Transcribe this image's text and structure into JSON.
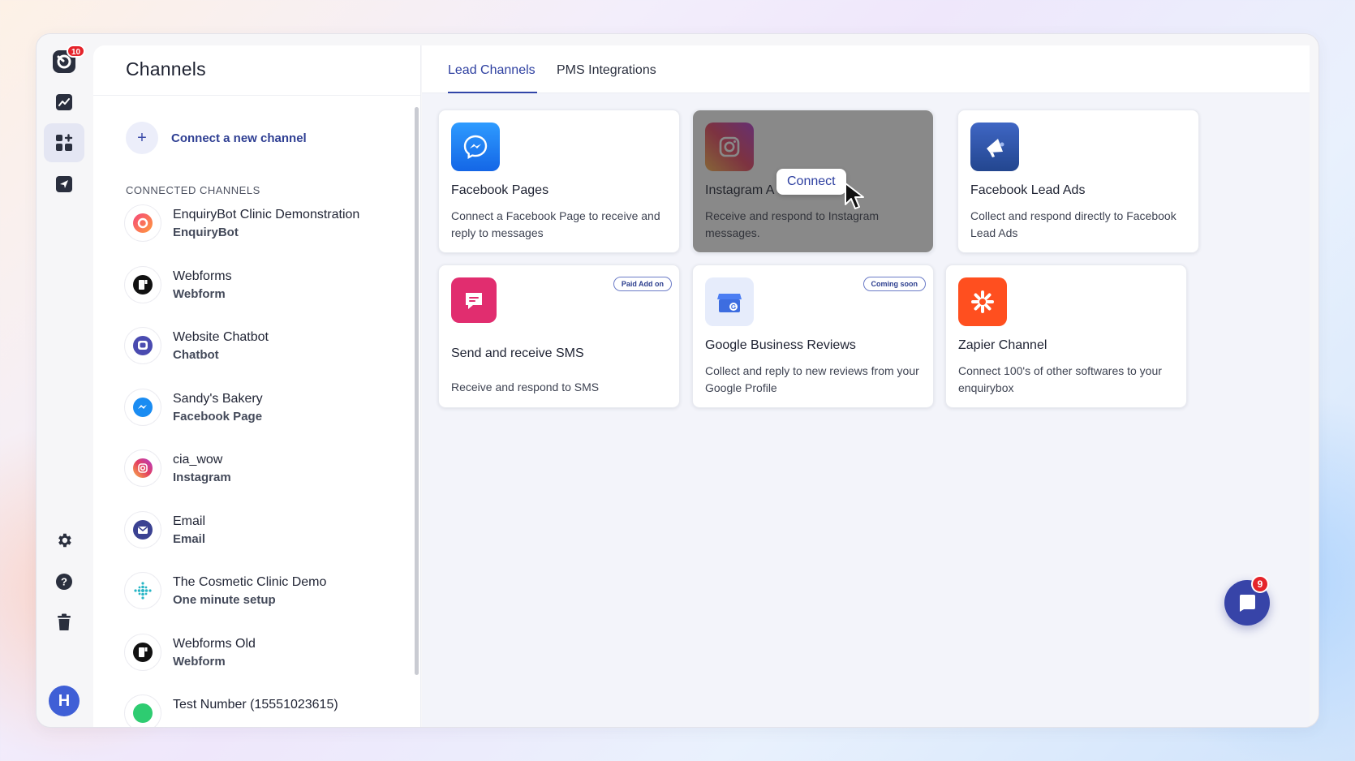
{
  "rail": {
    "logo_badge": "10",
    "avatar_initial": "H"
  },
  "panel": {
    "title": "Channels",
    "connect_new": "Connect a new channel",
    "section_label": "CONNECTED CHANNELS",
    "channels": [
      {
        "name": "EnquiryBot Clinic Demonstration",
        "type": "EnquiryBot",
        "icon": "enquirybot-icon"
      },
      {
        "name": "Webforms",
        "type": "Webform",
        "icon": "webform-icon"
      },
      {
        "name": "Website Chatbot",
        "type": "Chatbot",
        "icon": "chatbot-icon"
      },
      {
        "name": "Sandy's Bakery",
        "type": "Facebook Page",
        "icon": "messenger-icon"
      },
      {
        "name": "cia_wow",
        "type": "Instagram",
        "icon": "instagram-icon"
      },
      {
        "name": "Email",
        "type": "Email",
        "icon": "email-icon"
      },
      {
        "name": "The Cosmetic Clinic Demo",
        "type": "One minute setup",
        "icon": "sparkle-icon"
      },
      {
        "name": "Webforms Old",
        "type": "Webform",
        "icon": "webform-icon"
      },
      {
        "name": "Test Number (15551023615)",
        "type": "",
        "icon": "phone-icon"
      }
    ]
  },
  "tabs": [
    "Lead Channels",
    "PMS Integrations"
  ],
  "cards": [
    {
      "title": "Facebook Pages",
      "desc": "Connect a Facebook Page to receive and reply to messages"
    },
    {
      "title": "Instagram A",
      "desc": "Receive and respond to Instagram messages."
    },
    {
      "title": "Facebook Lead Ads",
      "desc": "Collect and respond directly to Facebook Lead Ads"
    },
    {
      "title": "Send and receive SMS",
      "desc": "Receive and respond to SMS",
      "pill": "Paid Add on"
    },
    {
      "title": "Google Business Reviews",
      "desc": "Collect and reply to new reviews from your Google Profile",
      "pill": "Coming soon"
    },
    {
      "title": "Zapier Channel",
      "desc": "Connect 100's of other softwares to your enquirybox"
    }
  ],
  "connect_tooltip": "Connect",
  "chat": {
    "badge": "9"
  },
  "colors": {
    "accent": "#3145a8",
    "badge": "#e5242b"
  }
}
